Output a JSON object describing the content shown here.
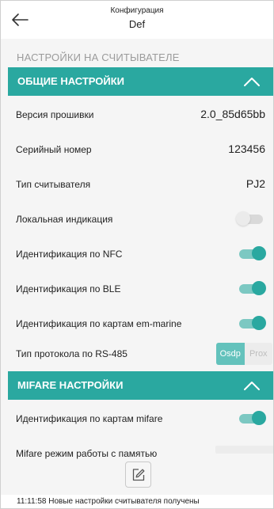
{
  "header": {
    "title": "Конфигурация",
    "subtitle": "Def",
    "back_icon": "arrow-left-icon"
  },
  "section_caption": "НАСТРОЙКИ НА СЧИТЫВАТЕЛЕ",
  "groups": {
    "general": {
      "title": "ОБЩИЕ НАСТРОЙКИ",
      "chevron_icon": "chevron-up-icon",
      "rows": {
        "firmware": {
          "label": "Версия прошивки",
          "value": "2.0_85d65bb"
        },
        "serial": {
          "label": "Серийный номер",
          "value": "123456"
        },
        "reader_type": {
          "label": "Тип считывателя",
          "value": "PJ2"
        },
        "local_indication": {
          "label": "Локальная индикация",
          "enabled": false
        },
        "nfc": {
          "label": "Идентификация по NFC",
          "enabled": true
        },
        "ble": {
          "label": "Идентификация по BLE",
          "enabled": true
        },
        "em_marine": {
          "label": "Идентификация по картам em-marine",
          "enabled": true
        },
        "rs485": {
          "label": "Тип протокола по RS-485",
          "options": [
            "Osdp",
            "Prox"
          ],
          "selected": "Osdp"
        }
      }
    },
    "mifare": {
      "title": "MIFARE НАСТРОЙКИ",
      "chevron_icon": "chevron-up-icon",
      "rows": {
        "mifare_id": {
          "label": "Идентификация по картам mifare",
          "enabled": true
        },
        "memory_mode": {
          "label": "Mifare режим работы с памятью"
        }
      }
    }
  },
  "edit_button_icon": "edit-icon",
  "status": "11:11:58 Новые настройки считывателя получены",
  "colors": {
    "accent": "#2aa8a0",
    "accent_light": "#7cc8c2",
    "background": "#f5f5f5"
  }
}
